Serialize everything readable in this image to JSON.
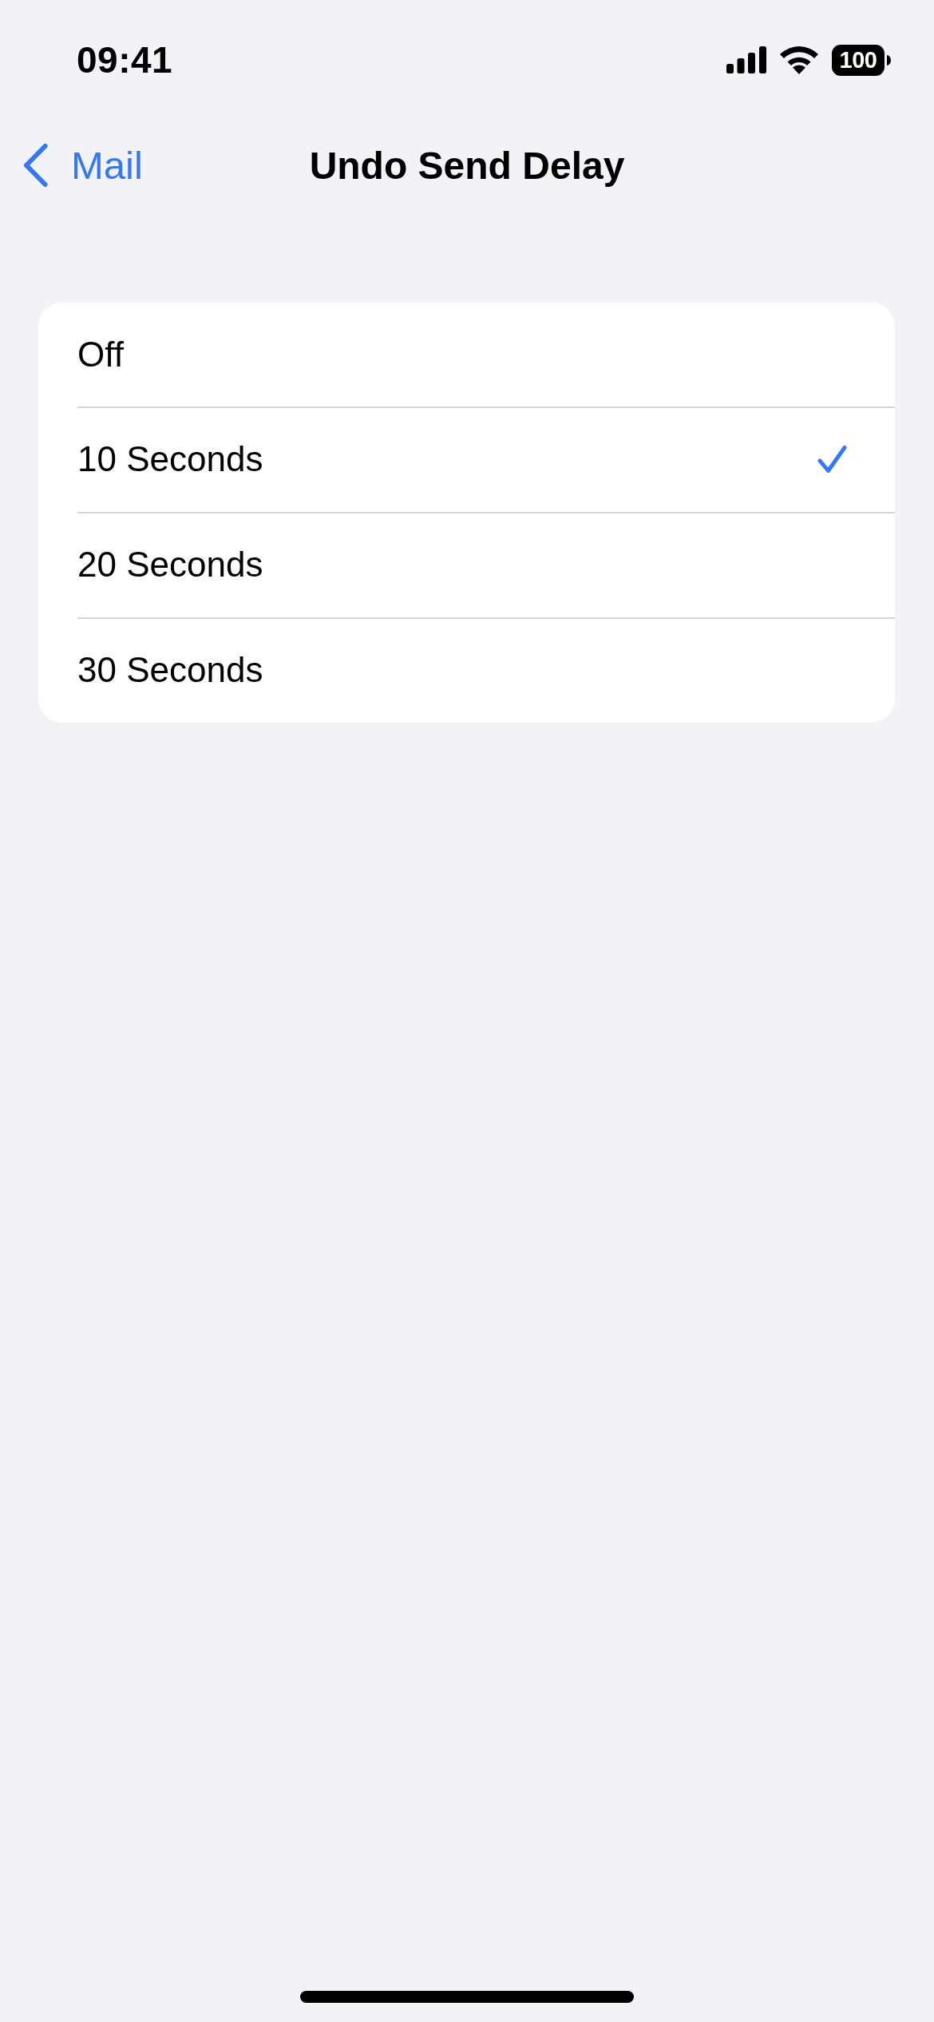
{
  "status_bar": {
    "time": "09:41",
    "battery": "100"
  },
  "nav_bar": {
    "back_label": "Mail",
    "title": "Undo Send Delay"
  },
  "options": [
    {
      "label": "Off",
      "selected": false
    },
    {
      "label": "10 Seconds",
      "selected": true
    },
    {
      "label": "20 Seconds",
      "selected": false
    },
    {
      "label": "30 Seconds",
      "selected": false
    }
  ]
}
